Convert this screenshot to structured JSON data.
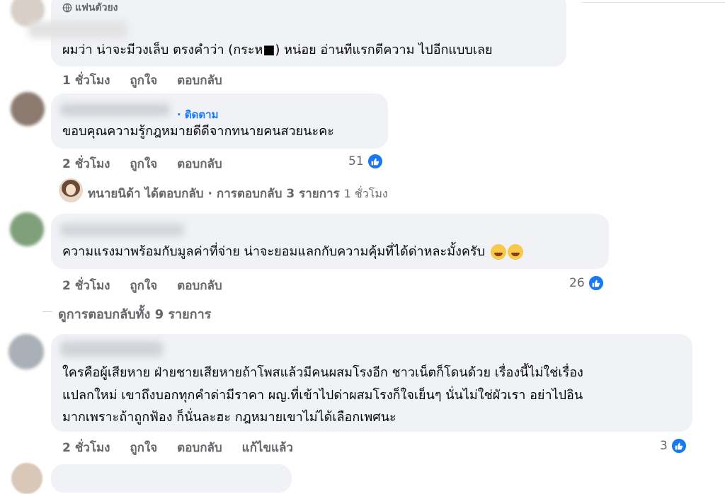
{
  "comments": [
    {
      "badge": "แฟนตัวยง",
      "text_lines": [
        "ผมว่า น่าจะมีวงเล็บ ตรงคำว่า (กระห■) หน่อย อ่านทีแรกตีความ ไปอีกแบบเลย"
      ],
      "time": "1 ชั่วโมง",
      "like": "ถูกใจ",
      "reply": "ตอบกลับ"
    },
    {
      "follow": "· ติดตาม",
      "text_lines": [
        "ขอบคุณความรู้กฎหมายดีดีจากทนายคนสวยนะคะ"
      ],
      "time": "2 ชั่วโมง",
      "like": "ถูกใจ",
      "reply": "ตอบกลับ",
      "reaction_count": "51",
      "reply_summary": {
        "author": "ทนายนิด้า",
        "action": "ได้ตอบกลับ",
        "sep": "·",
        "count_text": "การตอบกลับ 3 รายการ",
        "time": "1 ชั่วโมง"
      }
    },
    {
      "text_lines": [
        "ความแรงมาพร้อมกับมูลค่าที่จ่าย น่าจะยอมแลกกับความคุ้มที่ได้ด่าหละมั้งครับ"
      ],
      "time": "2 ชั่วโมง",
      "like": "ถูกใจ",
      "reply": "ตอบกลับ",
      "reaction_count": "26",
      "view_replies": "ดูการตอบกลับทั้ง 9 รายการ"
    },
    {
      "text_lines": [
        "ใครคือผู้เสียหาย ฝ่ายชายเสียหายถ้าโพสแล้วมีคนผสมโรงอีก ชาวเน็ตก็โดนด้วย เรื่องนี้ไม่ใช่เรื่อง",
        "แปลกใหม่ เขาถึงบอกทุกคำด่ามีราคา ผญ.ที่เข้าไปด่าผสมโรงก็ใจเย็นๆ นั่นไม่ใช่ผัวเรา อย่าไปอิน",
        "มากเพราะถ้าถูกฟ้อง ก็นั่นละฮะ กฎหมายเขาไม่ได้เลือกเพศนะ"
      ],
      "time": "2 ชั่วโมง",
      "like": "ถูกใจ",
      "reply": "ตอบกลับ",
      "edited": "แก้ไขแล้ว",
      "reaction_count": "3"
    }
  ],
  "colors": {
    "bubble": "#f0f2f5",
    "meta": "#65676b",
    "accent": "#1877f2"
  },
  "icons": {
    "like": "thumbs-up-icon",
    "badge": "globe-icon",
    "emoji": "grin-sweat-emoji"
  }
}
